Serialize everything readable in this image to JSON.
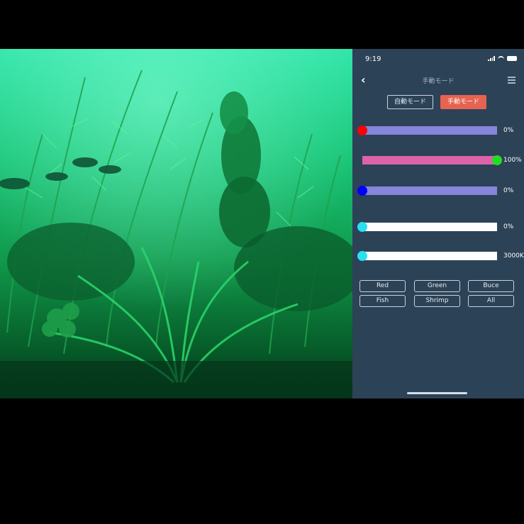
{
  "status_bar": {
    "time": "9:19"
  },
  "nav": {
    "title": "手動モード",
    "back_icon": "chevron-left-icon",
    "menu_icon": "list-icon"
  },
  "modes": {
    "auto_label": "自動モード",
    "manual_label": "手動モード",
    "active": "manual",
    "active_color": "#e56350"
  },
  "sliders": [
    {
      "name": "red",
      "value_text": "0%",
      "level": 0.0,
      "track_color": "#8585d9",
      "knob_color": "#ff0000"
    },
    {
      "name": "green",
      "value_text": "100%",
      "level": 1.0,
      "track_color": "#dd63a9",
      "knob_color": "#22dd22"
    },
    {
      "name": "blue",
      "value_text": "0%",
      "level": 0.0,
      "track_color": "#8585d9",
      "knob_color": "#0000ff"
    },
    {
      "name": "white",
      "value_text": "0%",
      "level": 0.0,
      "track_color": "#ffffff",
      "knob_color": "#29e0f2"
    },
    {
      "name": "color-temperature",
      "value_text": "3000K",
      "level": 0.0,
      "track_color": "#ffffff",
      "knob_color": "#29e0f2"
    }
  ],
  "presets": [
    "Red",
    "Green",
    "Buce",
    "Fish",
    "Shrimp",
    "All"
  ],
  "photo": {
    "subject": "green-lit planted aquarium",
    "tint": "#1fd98a"
  }
}
